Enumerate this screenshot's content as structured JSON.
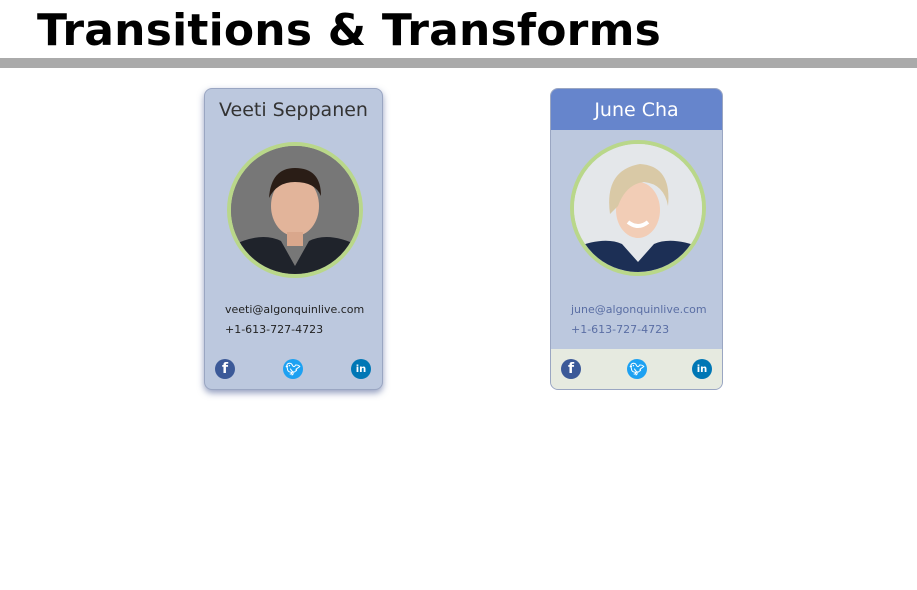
{
  "page": {
    "title": "Transitions & Transforms"
  },
  "cards": [
    {
      "name": "Veeti Seppanen",
      "email": "veeti@algonquinlive.com",
      "phone": "+1-613-727-4723",
      "social": [
        "facebook-icon",
        "twitter-icon",
        "linkedin-icon"
      ],
      "state": "hover"
    },
    {
      "name": "June Cha",
      "email": "june@algonquinlive.com",
      "phone": "+1-613-727-4723",
      "social": [
        "facebook-icon",
        "twitter-icon",
        "linkedin-icon"
      ],
      "state": "default"
    }
  ],
  "colors": {
    "card_bg": "#bcc8de",
    "header_active": "#6685cc",
    "avatar_ring": "#b9d78a",
    "footer_bg": "#e6eae0",
    "facebook": "#3b5998",
    "twitter": "#1da1f2",
    "linkedin": "#0077b5"
  }
}
